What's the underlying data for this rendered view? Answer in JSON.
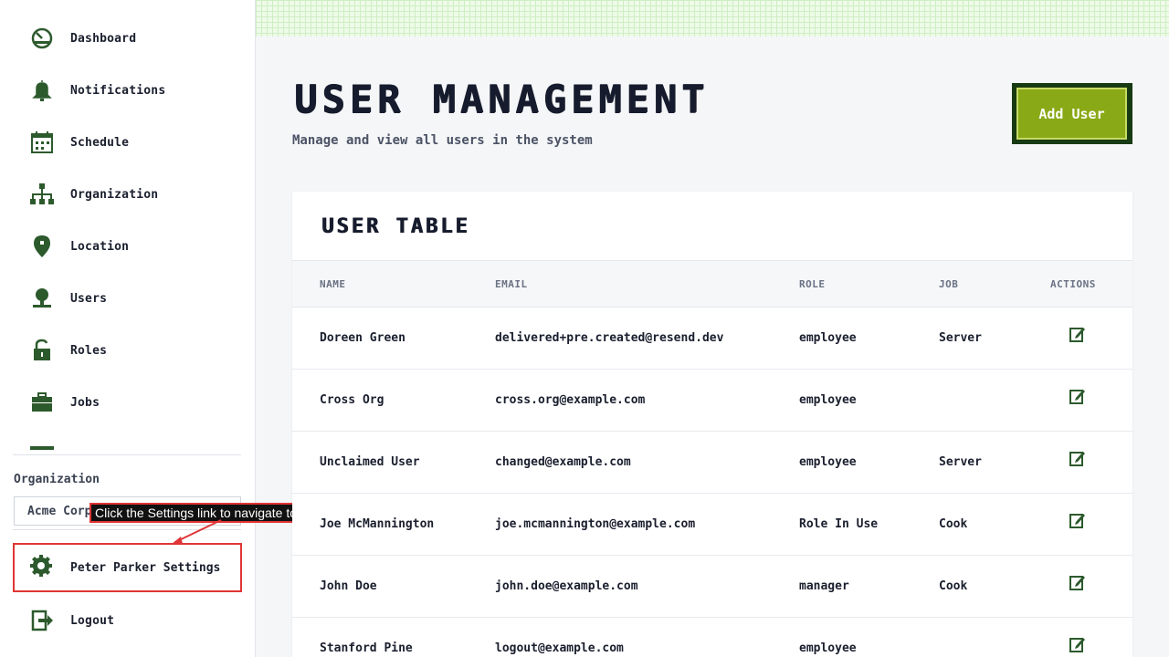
{
  "sidebar": {
    "items": [
      {
        "label": "Dashboard",
        "icon": "dashboard-icon"
      },
      {
        "label": "Notifications",
        "icon": "bell-icon"
      },
      {
        "label": "Schedule",
        "icon": "calendar-icon"
      },
      {
        "label": "Organization",
        "icon": "org-chart-icon"
      },
      {
        "label": "Location",
        "icon": "location-pin-icon"
      },
      {
        "label": "Users",
        "icon": "user-icon"
      },
      {
        "label": "Roles",
        "icon": "lock-icon"
      },
      {
        "label": "Jobs",
        "icon": "briefcase-icon"
      }
    ],
    "org_label": "Organization",
    "org_value": "Acme Corp",
    "settings_label": "Peter Parker Settings",
    "logout_label": "Logout"
  },
  "tooltip": "Click the Settings link to navigate to user settings",
  "header": {
    "title": "User Management",
    "subtitle": "Manage and view all users in the system",
    "add_user_label": "Add User"
  },
  "table": {
    "title": "User Table",
    "columns": [
      "NAME",
      "EMAIL",
      "ROLE",
      "JOB",
      "ACTIONS"
    ],
    "rows": [
      {
        "name": "Doreen Green",
        "email": "delivered+pre.created@resend.dev",
        "role": "employee",
        "job": "Server"
      },
      {
        "name": "Cross Org",
        "email": "cross.org@example.com",
        "role": "employee",
        "job": ""
      },
      {
        "name": "Unclaimed User",
        "email": "changed@example.com",
        "role": "employee",
        "job": "Server"
      },
      {
        "name": "Joe McMannington",
        "email": "joe.mcmannington@example.com",
        "role": "Role In Use",
        "job": "Cook"
      },
      {
        "name": "John Doe",
        "email": "john.doe@example.com",
        "role": "manager",
        "job": "Cook"
      },
      {
        "name": "Stanford Pine",
        "email": "logout@example.com",
        "role": "employee",
        "job": ""
      }
    ]
  },
  "colors": {
    "accent_green": "#8aa916",
    "dark_green": "#173a12",
    "icon_green": "#2d5a2d",
    "highlight_red": "#e03535"
  }
}
